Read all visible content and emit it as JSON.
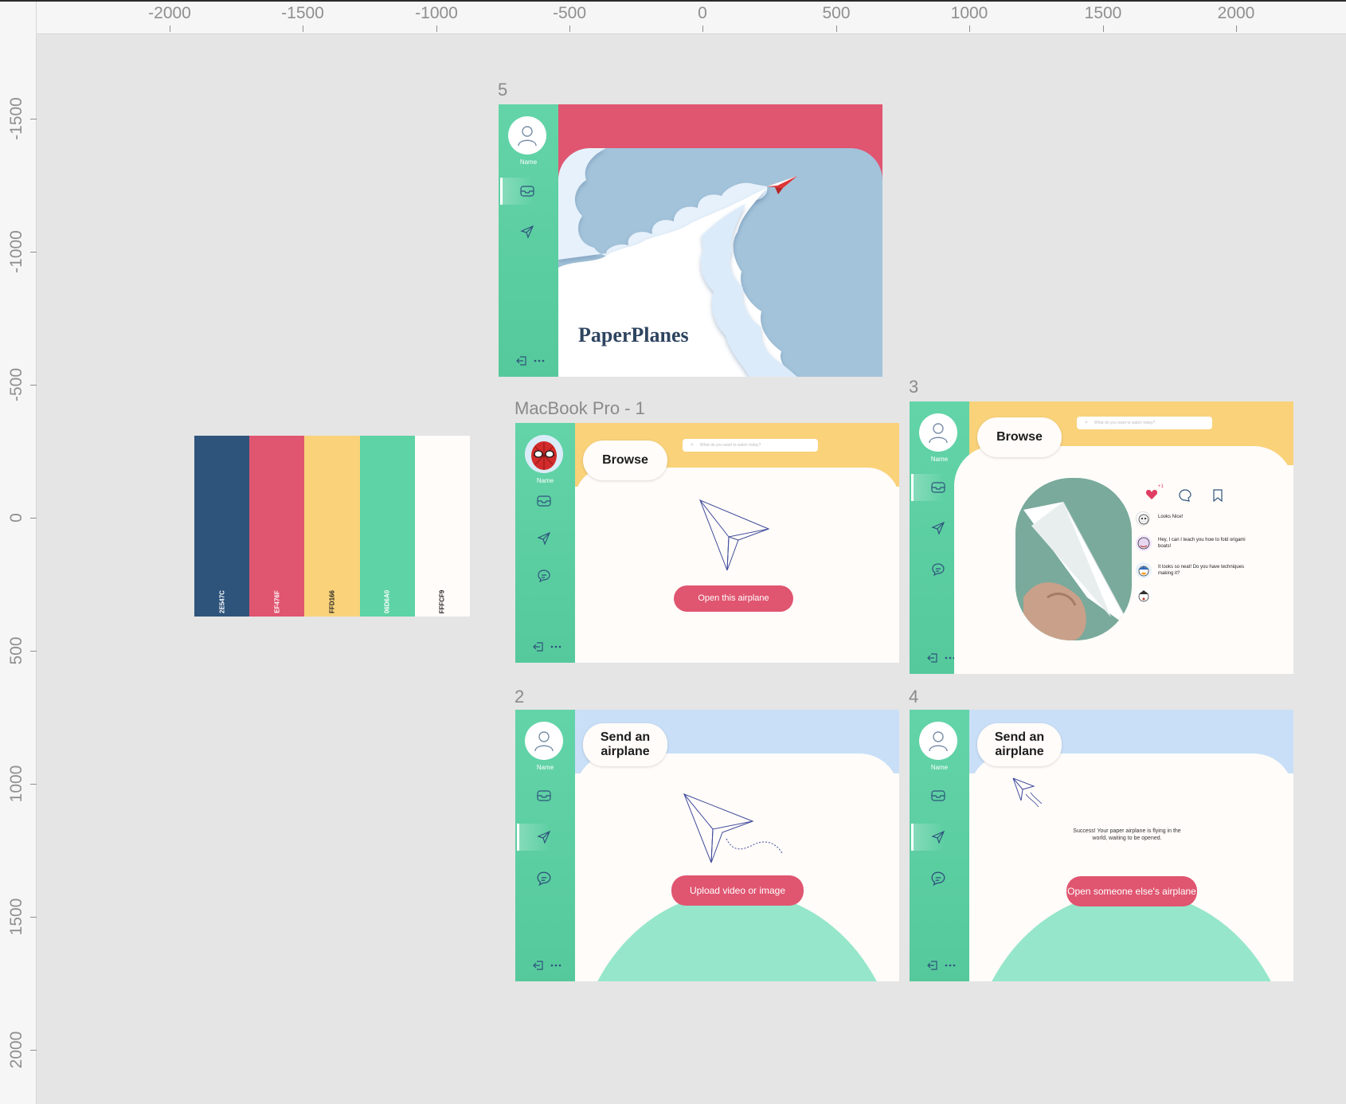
{
  "ruler": {
    "x_ticks": [
      "-2000",
      "-1500",
      "-1000",
      "-500",
      "0",
      "500",
      "1000",
      "1500",
      "2000"
    ],
    "y_ticks": [
      "-1500",
      "-1000",
      "-500",
      "0",
      "500",
      "1000",
      "1500",
      "2000"
    ]
  },
  "palette": {
    "swatches": [
      {
        "hex": "#2E547C",
        "label": "2E547C"
      },
      {
        "hex": "#EF476F",
        "label": "EF476F"
      },
      {
        "hex": "#FFD166",
        "label": "FFD166"
      },
      {
        "hex": "#06D6A0",
        "label": "06D6A0"
      },
      {
        "hex": "#FFFCF9",
        "label": "FFFCF9"
      }
    ]
  },
  "frames": {
    "f5": {
      "label": "5",
      "logo": "PaperPlanes",
      "name": "Name"
    },
    "f1": {
      "label": "MacBook Pro - 1",
      "pill": "Browse",
      "search": "What do you want to watch today?",
      "name": "Name",
      "button": "Open this airplane"
    },
    "f3": {
      "label": "3",
      "pill": "Browse",
      "search": "What do you want to watch today?",
      "name": "Name",
      "like_count": "+1",
      "comments": [
        "Looks Nice!",
        "Hey, I can I teach you how to fold origami boats!",
        "It looks so neat! Do you have techniques making it?"
      ]
    },
    "f2": {
      "label": "2",
      "pill": "Send an airplane",
      "name": "Name",
      "button": "Upload video or image"
    },
    "f4": {
      "label": "4",
      "pill": "Send an airplane",
      "name": "Name",
      "message": "Success! Your paper airplane is flying in the world, waiting to be opened.",
      "button": "Open someone else's airplane"
    }
  },
  "colors": {
    "green": "#5ED3A5",
    "red": "#E05570",
    "yellow": "#F9D27A",
    "sky": "#C9DFF7",
    "cream": "#FFFCF9",
    "navy": "#2E547C"
  }
}
